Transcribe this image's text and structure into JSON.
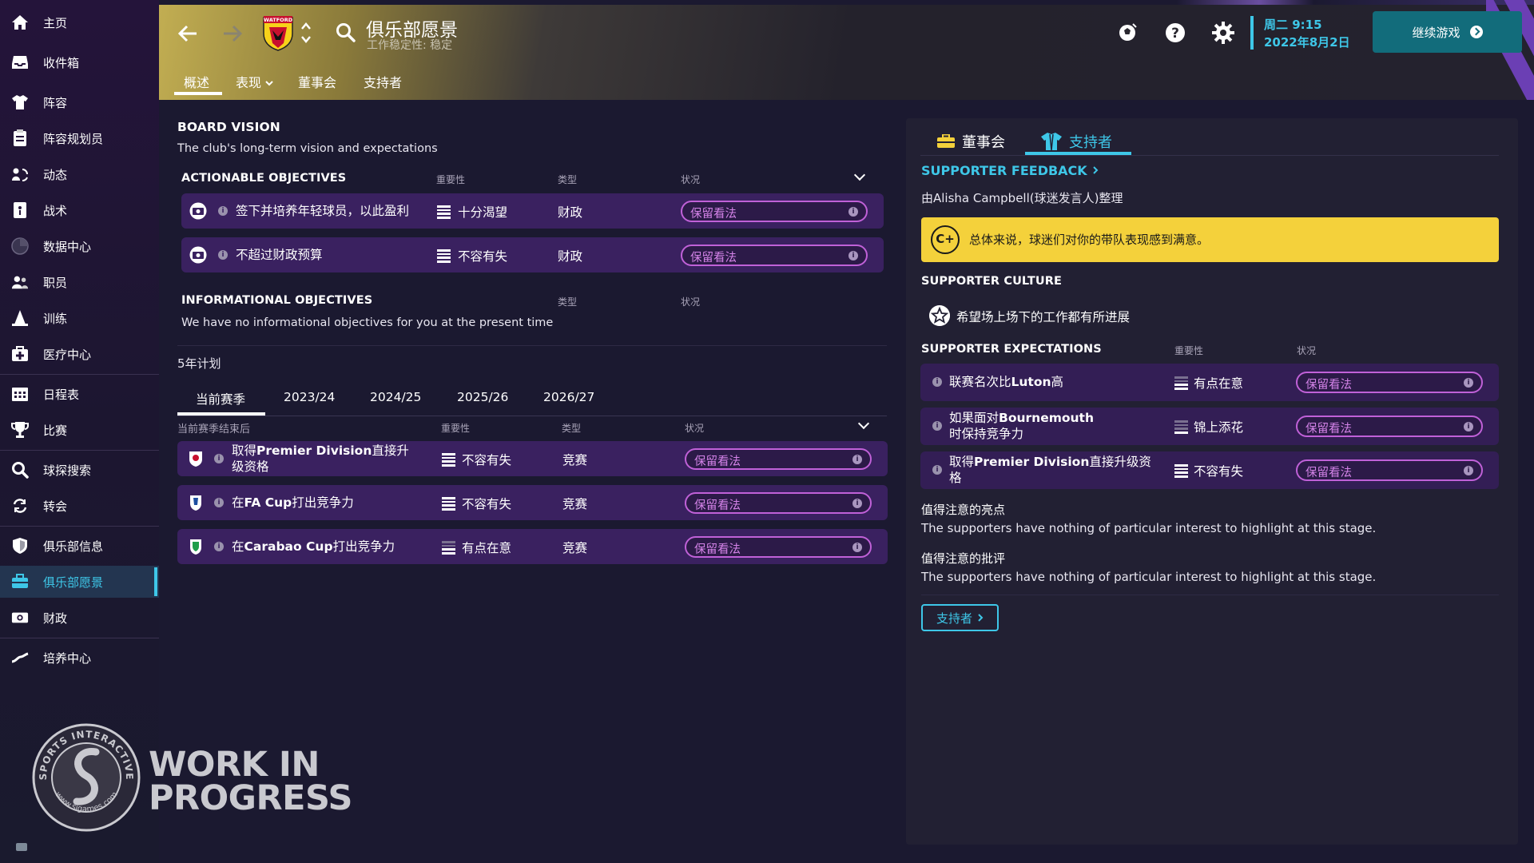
{
  "sidebar": {
    "items": [
      {
        "label": "主页",
        "icon": "home-icon"
      },
      {
        "label": "收件箱",
        "icon": "inbox-icon"
      },
      {
        "label": "阵容",
        "icon": "shirt-icon"
      },
      {
        "label": "阵容规划员",
        "icon": "clipboard-icon"
      },
      {
        "label": "动态",
        "icon": "dynamics-icon"
      },
      {
        "label": "战术",
        "icon": "tactics-icon"
      },
      {
        "label": "数据中心",
        "icon": "data-hub-icon"
      },
      {
        "label": "职员",
        "icon": "staff-icon"
      },
      {
        "label": "训练",
        "icon": "training-cone-icon"
      },
      {
        "label": "医疗中心",
        "icon": "medical-kit-icon"
      },
      {
        "label": "日程表",
        "icon": "calendar-icon"
      },
      {
        "label": "比赛",
        "icon": "trophy-icon"
      },
      {
        "label": "球探搜索",
        "icon": "magnifier-icon"
      },
      {
        "label": "转会",
        "icon": "transfer-arrows-icon"
      },
      {
        "label": "俱乐部信息",
        "icon": "shield-icon"
      },
      {
        "label": "俱乐部愿景",
        "icon": "briefcase-icon",
        "active": true
      },
      {
        "label": "财政",
        "icon": "money-icon"
      },
      {
        "label": "培养中心",
        "icon": "development-icon"
      }
    ]
  },
  "watermark": {
    "line1": "WORK IN",
    "line2": "PROGRESS",
    "logo_text_top": "SPORTS INTERACTIVE",
    "logo_text_bottom": "www.sigames.com"
  },
  "header": {
    "title": "俱乐部愿景",
    "subtitle": "工作稳定性: 稳定",
    "badge_text": "WATFORD",
    "subnav": [
      "概述",
      "表现",
      "董事会",
      "支持者"
    ],
    "day_time": "周二 9:15",
    "date": "2022年8月2日",
    "continue_label": "继续游戏"
  },
  "board_vision": {
    "title": "BOARD VISION",
    "subtitle": "The club's long-term vision and expectations",
    "actionable_title": "ACTIONABLE OBJECTIVES",
    "col_importance": "重要性",
    "col_type": "类型",
    "col_status": "状况",
    "actionable": [
      {
        "text": "签下并培养年轻球员，以此盈利",
        "importance": "十分渴望",
        "type": "财政",
        "status": "保留看法"
      },
      {
        "text": "不超过财政预算",
        "importance": "不容有失",
        "type": "财政",
        "status": "保留看法"
      }
    ],
    "informational_title": "INFORMATIONAL OBJECTIVES",
    "informational_text": "We have no informational objectives for you at the present time"
  },
  "plan": {
    "title": "5年计划",
    "tabs": [
      "当前赛季",
      "2023/24",
      "2024/25",
      "2025/26",
      "2026/27"
    ],
    "col_when": "当前赛季结束后",
    "col_importance": "重要性",
    "col_type": "类型",
    "col_status": "状况",
    "rows": [
      {
        "text_a": "取得",
        "text_b": "Premier Division",
        "text_c": "直接升",
        "text_line2": "级资格",
        "importance": "不容有失",
        "type": "竞赛",
        "status": "保留看法"
      },
      {
        "text_a": "在",
        "text_b": "FA Cup",
        "text_c": "打出竞争力",
        "importance": "不容有失",
        "type": "竞赛",
        "status": "保留看法"
      },
      {
        "text_a": "在",
        "text_b": "Carabao Cup",
        "text_c": "打出竞争力",
        "importance": "有点在意",
        "type": "竞赛",
        "status": "保留看法"
      }
    ]
  },
  "right": {
    "tabs": [
      "董事会",
      "支持者"
    ],
    "feedback_title": "SUPPORTER FEEDBACK",
    "compiled_by": "由Alisha Campbell(球迷发言人)整理",
    "grade": "C+",
    "summary": "总体来说，球迷们对你的带队表现感到满意。",
    "culture_title": "SUPPORTER CULTURE",
    "culture_item": "希望场上场下的工作都有所进展",
    "expectations_title": "SUPPORTER EXPECTATIONS",
    "col_importance": "重要性",
    "col_status": "状况",
    "expectations": [
      {
        "line1_a": "联赛名次比",
        "line1_b": "Luton",
        "line1_c": "高",
        "importance": "有点在意",
        "status": "保留看法"
      },
      {
        "line1_a": "如果面对",
        "line1_b": "Bournemouth",
        "line1_c": "",
        "line2": "时保持竞争力",
        "importance": "锦上添花",
        "status": "保留看法"
      },
      {
        "line1_a": "取得",
        "line1_b": "Premier Division",
        "line1_c": "直接升级资",
        "line2": "格",
        "importance": "不容有失",
        "status": "保留看法"
      }
    ],
    "highlights_title": "值得注意的亮点",
    "highlights_text": "The supporters have nothing of particular interest to highlight at this stage.",
    "criticism_title": "值得注意的批评",
    "criticism_text": "The supporters have nothing of particular interest to highlight at this stage.",
    "supporters_button": "支持者"
  },
  "colors": {
    "accent": "#3ec7e8",
    "status_pill": "#c061d8",
    "row_bg": "#3a2160",
    "feedback_box": "#f4d13b"
  }
}
